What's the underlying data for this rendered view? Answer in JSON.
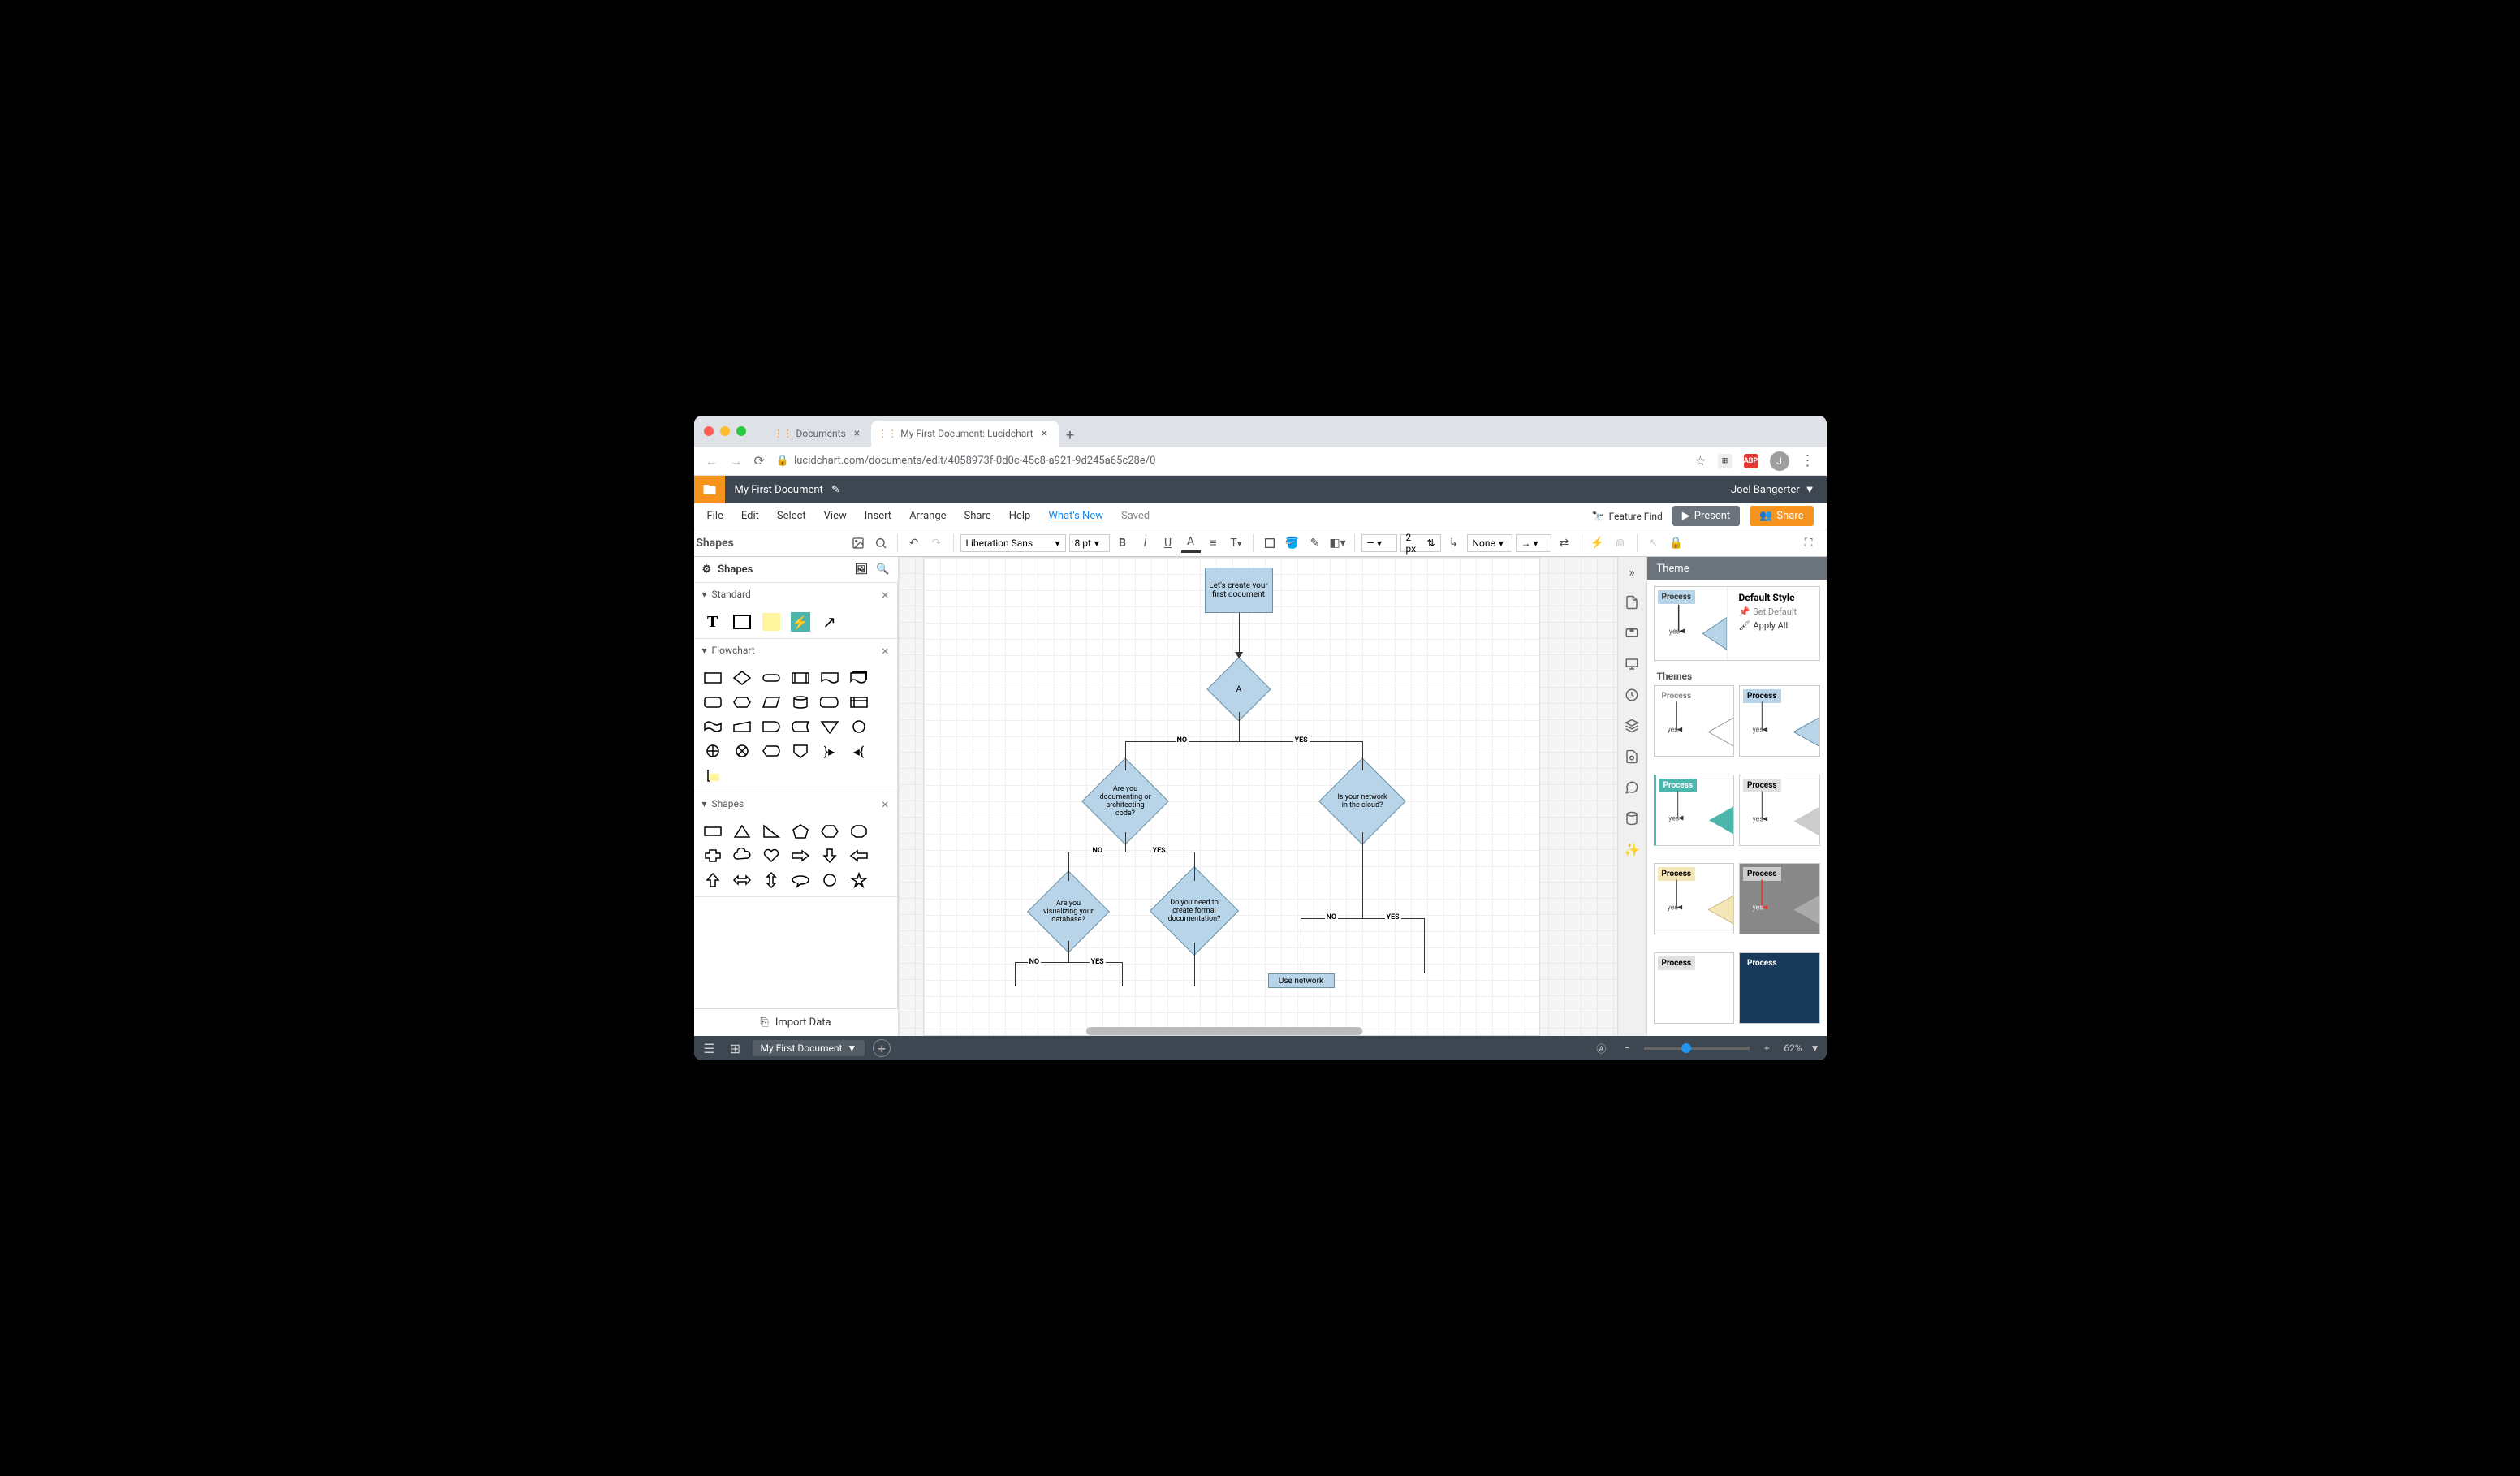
{
  "browser": {
    "tabs": [
      {
        "label": "Documents",
        "active": false
      },
      {
        "label": "My First Document: Lucidchart",
        "active": true
      }
    ],
    "url": "lucidchart.com/documents/edit/4058973f-0d0c-45c8-a921-9d245a65c28e/0",
    "avatar_initial": "J"
  },
  "app": {
    "doc_title": "My First Document",
    "user": "Joel Bangerter",
    "menus": [
      "File",
      "Edit",
      "Select",
      "View",
      "Insert",
      "Arrange",
      "Share",
      "Help"
    ],
    "whats_new": "What's New",
    "saved": "Saved",
    "feature_find": "Feature Find",
    "present": "Present",
    "share": "Share"
  },
  "toolbar": {
    "font": "Liberation Sans",
    "font_size": "8 pt",
    "stroke_width": "2 px",
    "label_pos": "None"
  },
  "left": {
    "shapes_title": "Shapes",
    "sections": {
      "standard": "Standard",
      "flowchart": "Flowchart",
      "shapes": "Shapes"
    },
    "import": "Import Data"
  },
  "right": {
    "theme_title": "Theme",
    "default_style": "Default Style",
    "set_default": "Set Default",
    "apply_all": "Apply All",
    "themes_label": "Themes",
    "process": "Process",
    "yes": "yes"
  },
  "canvas": {
    "n1": "Let's create your first document",
    "n2": "A",
    "n3": "Are you documenting or architecting code?",
    "n4": "Is your network in the cloud?",
    "n5": "Are you visualizing your database?",
    "n6": "Do you need to create formal documentation?",
    "n7": "Use network",
    "no": "NO",
    "yes": "YES"
  },
  "status": {
    "page": "My First Document",
    "zoom": "62%"
  }
}
